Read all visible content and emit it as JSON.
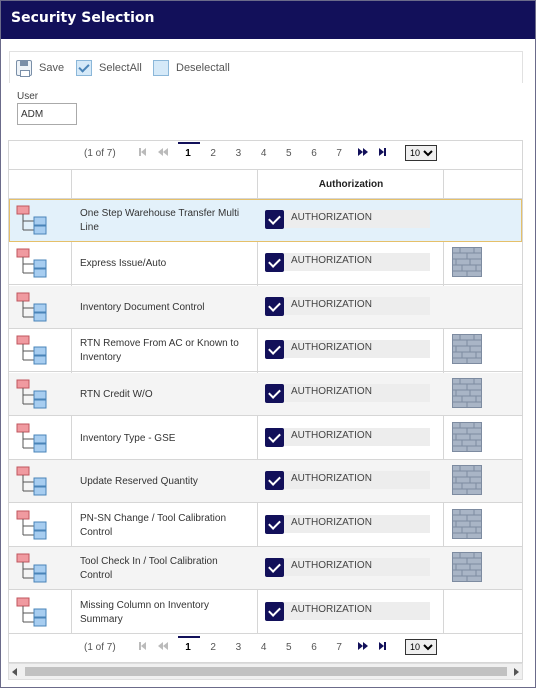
{
  "window": {
    "title": "Security Selection"
  },
  "toolbar": {
    "save_label": "Save",
    "select_all_label": "SelectAll",
    "deselect_all_label": "Deselectall"
  },
  "user": {
    "label": "User",
    "value": "ADM"
  },
  "pager": {
    "info": "(1 of 7)",
    "pages": [
      "1",
      "2",
      "3",
      "4",
      "5",
      "6",
      "7"
    ],
    "current": "1",
    "page_size": "10"
  },
  "grid": {
    "columns": {
      "authorization": "Authorization"
    },
    "rows": [
      {
        "name": "One Step Warehouse Transfer Multi Line",
        "auth": "AUTHORIZATION",
        "checked": true,
        "has_brick": false,
        "selected": true
      },
      {
        "name": "Express Issue/Auto",
        "auth": "AUTHORIZATION",
        "checked": true,
        "has_brick": true
      },
      {
        "name": "Inventory Document Control",
        "auth": "AUTHORIZATION",
        "checked": true,
        "has_brick": false
      },
      {
        "name": "RTN Remove From AC or Known to Inventory",
        "auth": "AUTHORIZATION",
        "checked": true,
        "has_brick": true
      },
      {
        "name": "RTN Credit W/O",
        "auth": "AUTHORIZATION",
        "checked": true,
        "has_brick": true
      },
      {
        "name": "Inventory Type - GSE",
        "auth": "AUTHORIZATION",
        "checked": true,
        "has_brick": true
      },
      {
        "name": "Update Reserved Quantity",
        "auth": "AUTHORIZATION",
        "checked": true,
        "has_brick": true
      },
      {
        "name": "PN-SN Change / Tool Calibration Control",
        "auth": "AUTHORIZATION",
        "checked": true,
        "has_brick": true
      },
      {
        "name": "Tool Check In / Tool Calibration Control",
        "auth": "AUTHORIZATION",
        "checked": true,
        "has_brick": true
      },
      {
        "name": "Missing Column on Inventory Summary",
        "auth": "AUTHORIZATION",
        "checked": true,
        "has_brick": false
      }
    ]
  },
  "colors": {
    "title_bar": "#12105a",
    "check": "#12105a",
    "selected_row": "#e3f1fa"
  }
}
